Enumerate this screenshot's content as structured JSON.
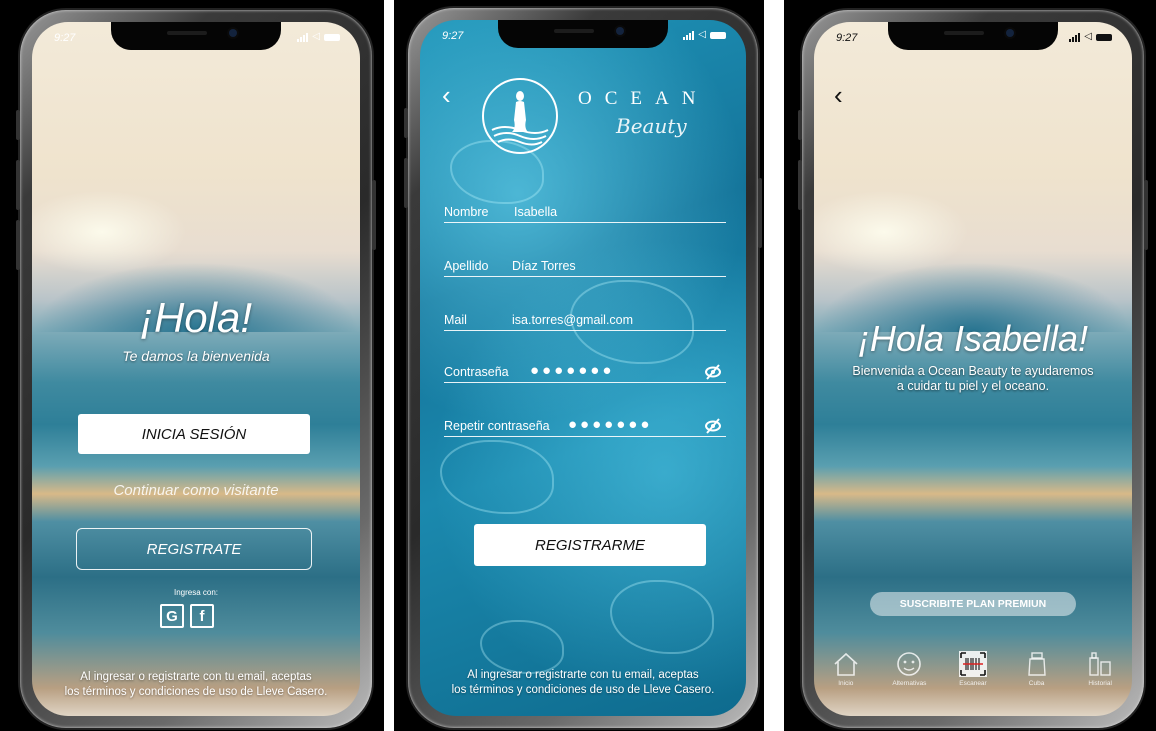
{
  "status_bar": {
    "time": "9:27"
  },
  "screen_welcome": {
    "greeting": "¡Hola!",
    "subtitle": "Te damos la bienvenida",
    "login_button": "INICIA SESIÓN",
    "guest_link": "Continuar como visitante",
    "register_button": "REGISTRATE",
    "social_label": "Ingresa con:",
    "google_icon_letter": "G",
    "facebook_icon_letter": "f",
    "terms_line1": "Al ingresar o registrarte con tu email, aceptas",
    "terms_line2": "los términos y condiciones de uso de Lleve Casero."
  },
  "screen_register": {
    "back_icon": "chevron-left",
    "brand_top": "OCEAN",
    "brand_bottom": "Beauty",
    "fields": [
      {
        "label": "Nombre",
        "value": "Isabella"
      },
      {
        "label": "Apellido",
        "value": "Díaz Torres"
      },
      {
        "label": "Mail",
        "value": "isa.torres@gmail.com"
      },
      {
        "label": "Contraseña",
        "value": "●●●●●●●"
      },
      {
        "label": "Repetir contraseña",
        "value": "●●●●●●●"
      }
    ],
    "submit_button": "REGISTRARME",
    "terms_line1": "Al ingresar o registrarte con tu email, aceptas",
    "terms_line2": "los términos y condiciones de uso de Lleve Casero."
  },
  "screen_home": {
    "back_icon": "chevron-left",
    "greeting": "¡Hola Isabella!",
    "message_line1": "Bienvenida a Ocean Beauty te ayudaremos",
    "message_line2": "a cuidar tu piel y el oceano.",
    "premium_button": "SUSCRIBITE PLAN PREMIUN",
    "nav": [
      {
        "label": "Inicio",
        "icon": "home-icon"
      },
      {
        "label": "Alternativas",
        "icon": "face-icon"
      },
      {
        "label": "Escanear",
        "icon": "barcode-scan-icon"
      },
      {
        "label": "Cuba",
        "icon": "jar-icon"
      },
      {
        "label": "Historial",
        "icon": "bottles-icon"
      }
    ]
  },
  "colors": {
    "frame_background": "#000000",
    "button_white": "#ffffff",
    "text_primary": "#ffffff",
    "pool_blue": "#1f94b8"
  }
}
